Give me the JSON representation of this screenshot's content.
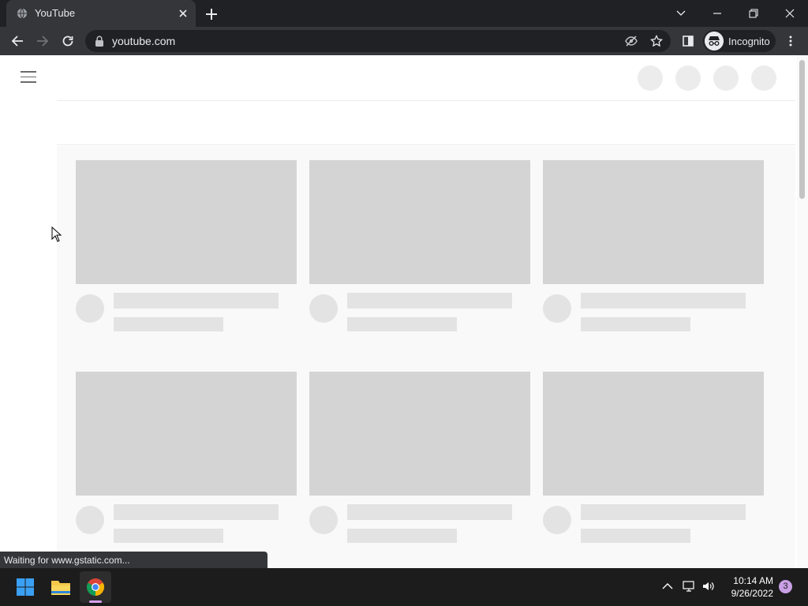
{
  "browser": {
    "tab": {
      "title": "YouTube"
    },
    "address": {
      "url": "youtube.com"
    },
    "profile": {
      "label": "Incognito"
    },
    "status_text": "Waiting for www.gstatic.com..."
  },
  "page": {
    "placeholder_cards": 6
  },
  "taskbar": {
    "time": "10:14 AM",
    "date": "9/26/2022",
    "notification_count": "3"
  },
  "colors": {
    "browser_dark": "#202124",
    "toolbar": "#35363a",
    "skeleton_thumb": "#d4d4d4",
    "skeleton_line": "#e3e3e3",
    "chrome_indicator": "#d6a3f1"
  }
}
